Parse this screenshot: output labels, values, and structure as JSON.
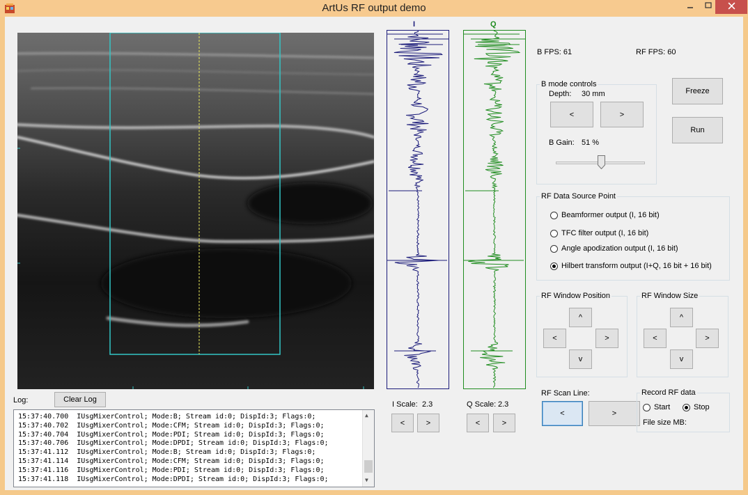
{
  "window": {
    "title": "ArtUs RF output demo",
    "min_icon": "minimize-glyph",
    "max_icon": "maximize-glyph",
    "close_icon": "close-glyph"
  },
  "stats": {
    "b_fps": "B FPS: 61",
    "rf_fps": "RF FPS: 60"
  },
  "bmode": {
    "group_label": "B mode controls",
    "depth_label": "Depth:",
    "depth_value": "30 mm",
    "depth_dec": "<",
    "depth_inc": ">",
    "gain_label": "B Gain:",
    "gain_value": "51 %",
    "gain_fraction": 0.51
  },
  "buttons": {
    "freeze": "Freeze",
    "run": "Run",
    "clear_log": "Clear Log"
  },
  "rf_source": {
    "group_label": "RF Data Source Point",
    "options": [
      "Beamformer output (I, 16 bit)",
      "TFC filter output (I, 16 bit)",
      "Angle apodization output (I, 16 bit)",
      "Hilbert transform output (I+Q, 16 bit + 16 bit)"
    ],
    "selected_index": 3
  },
  "rf_window_position": {
    "group_label": "RF Window Position",
    "up": "^",
    "left": "<",
    "right": ">",
    "down": "v"
  },
  "rf_window_size": {
    "group_label": "RF Window Size",
    "up": "^",
    "left": "<",
    "right": ">",
    "down": "v"
  },
  "rf_scan_line": {
    "label": "RF Scan Line:",
    "prev": "<",
    "next": ">"
  },
  "record": {
    "group_label": "Record RF data",
    "start": "Start",
    "stop": "Stop",
    "selected": "Stop",
    "file_size_label": "File size MB:"
  },
  "signals": {
    "i_title": "I",
    "q_title": "Q",
    "i_color": "#1b1b7a",
    "q_color": "#1f8c1f",
    "i_scale_label": "I Scale:",
    "i_scale_value": "2.3",
    "q_scale_label": "Q Scale:",
    "q_scale_value": "2.3",
    "i_dec": "<",
    "i_inc": ">",
    "q_dec": "<",
    "q_inc": ">"
  },
  "log": {
    "label": "Log:",
    "lines": [
      "15:37:40.700  IUsgMixerControl; Mode:B; Stream id:0; DispId:3; Flags:0;",
      "15:37:40.702  IUsgMixerControl; Mode:CFM; Stream id:0; DispId:3; Flags:0;",
      "15:37:40.704  IUsgMixerControl; Mode:PDI; Stream id:0; DispId:3; Flags:0;",
      "15:37:40.706  IUsgMixerControl; Mode:DPDI; Stream id:0; DispId:3; Flags:0;",
      "15:37:41.112  IUsgMixerControl; Mode:B; Stream id:0; DispId:3; Flags:0;",
      "15:37:41.114  IUsgMixerControl; Mode:CFM; Stream id:0; DispId:3; Flags:0;",
      "15:37:41.116  IUsgMixerControl; Mode:PDI; Stream id:0; DispId:3; Flags:0;",
      "15:37:41.118  IUsgMixerControl; Mode:DPDI; Stream id:0; DispId:3; Flags:0;"
    ],
    "scroll_up": "▲",
    "scroll_down": "▼"
  },
  "colors": {
    "accent_roi": "#33c6c6",
    "scanline": "#e8e85a"
  }
}
